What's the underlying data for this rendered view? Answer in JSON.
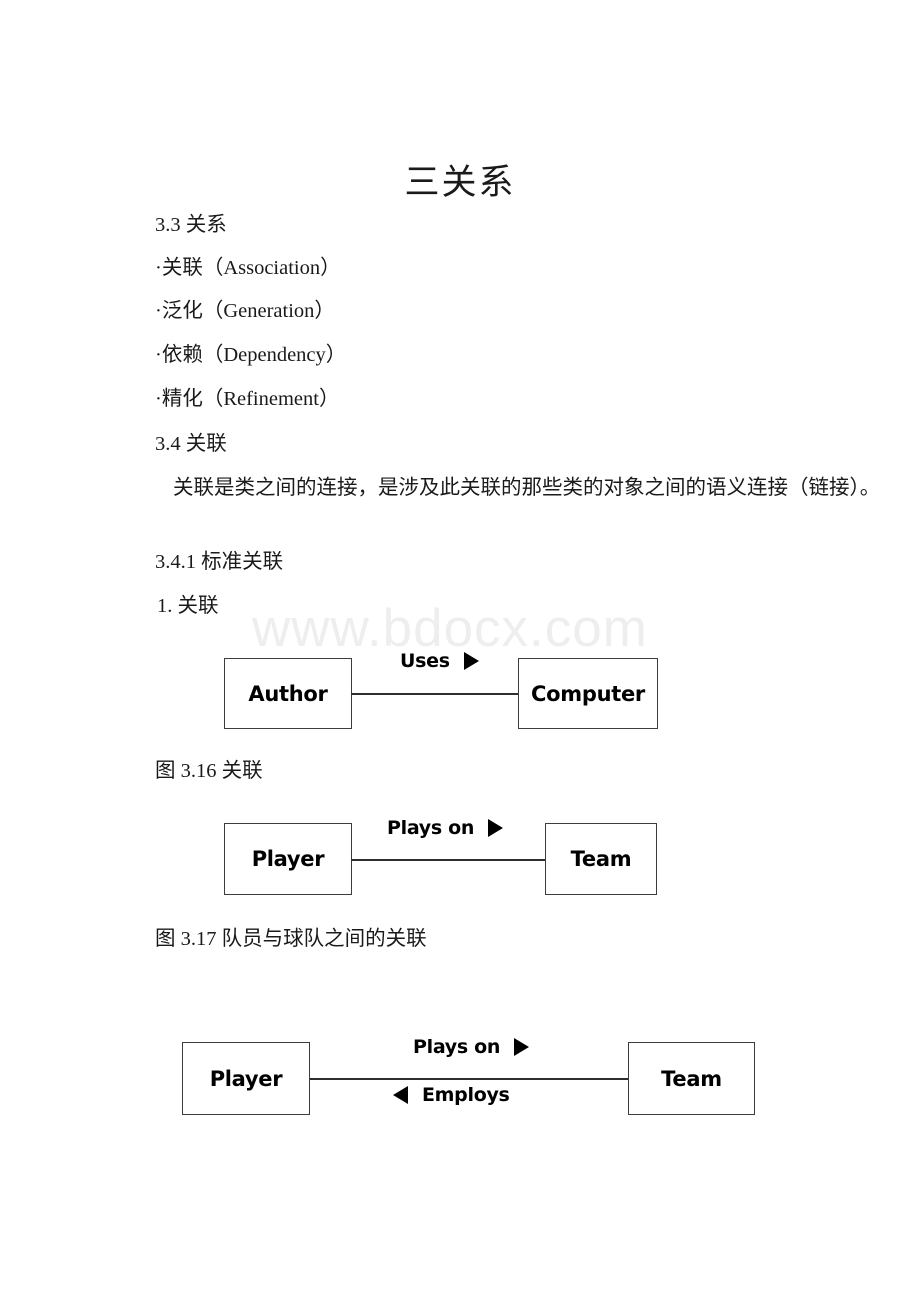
{
  "document": {
    "title": "三关系",
    "watermark": "www.bdocx.com"
  },
  "sections": {
    "heading_3_3": "3.3 关系",
    "bullets": [
      "·关联（Association）",
      "·泛化（Generation）",
      "·依赖（Dependency）",
      "·精化（Refinement）"
    ],
    "heading_3_4": "3.4 关联",
    "body_paragraph": "关联是类之间的连接，是涉及此关联的那些类的对象之间的语义连接（链接）。",
    "heading_3_4_1": "3.4.1 标准关联",
    "item_1": "1. 关联"
  },
  "figures": [
    {
      "id": "figure-3-16",
      "caption": "图 3.16 关联",
      "type": "uml-association",
      "left_class": "Author",
      "right_class": "Computer",
      "labels": [
        {
          "text": "Uses",
          "arrow": "right"
        }
      ]
    },
    {
      "id": "figure-3-17",
      "caption": "图 3.17 队员与球队之间的关联",
      "type": "uml-association",
      "left_class": "Player",
      "right_class": "Team",
      "labels": [
        {
          "text": "Plays on",
          "arrow": "right"
        }
      ]
    },
    {
      "id": "figure-bidirectional",
      "caption": "",
      "type": "uml-association-bidirectional",
      "left_class": "Player",
      "right_class": "Team",
      "labels": [
        {
          "text": "Plays on",
          "arrow": "right"
        },
        {
          "text": "Employs",
          "arrow": "left"
        }
      ]
    }
  ],
  "colors": {
    "text": "#1a1a1a",
    "box_border": "#3c3c3c",
    "connector": "#2e2e2e",
    "watermark": "#eeeeee",
    "page_background": "#ffffff"
  }
}
